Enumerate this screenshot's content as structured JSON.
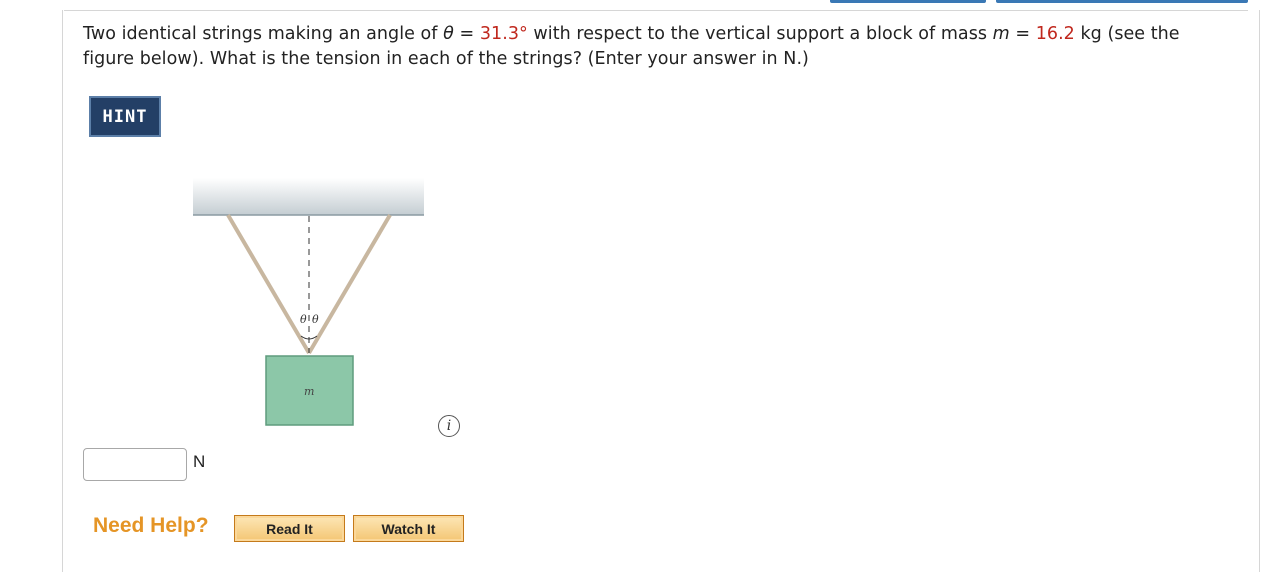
{
  "question": {
    "part1": "Two identical strings making an angle of ",
    "theta_symbol": "θ",
    "eq1": " = ",
    "theta_value": "31.3°",
    "part2": " with respect to the vertical support a block of mass ",
    "mass_symbol": "m",
    "eq2": " = ",
    "mass_value": "16.2",
    "part3": " kg (see the figure below). What is the tension in each of the strings? (Enter your answer in N.)"
  },
  "hint_label": "HINT",
  "figure": {
    "theta_left": "θ",
    "theta_right": "θ",
    "mass_label": "m"
  },
  "info_icon_glyph": "i",
  "answer": {
    "value": "",
    "placeholder": "",
    "unit": "N"
  },
  "help": {
    "label": "Need Help?",
    "read_label": "Read It",
    "watch_label": "Watch It"
  },
  "colors": {
    "value_red": "#c0281e",
    "hint_bg": "#233f66",
    "help_orange": "#e59526",
    "block_green": "#8cc7a8"
  }
}
